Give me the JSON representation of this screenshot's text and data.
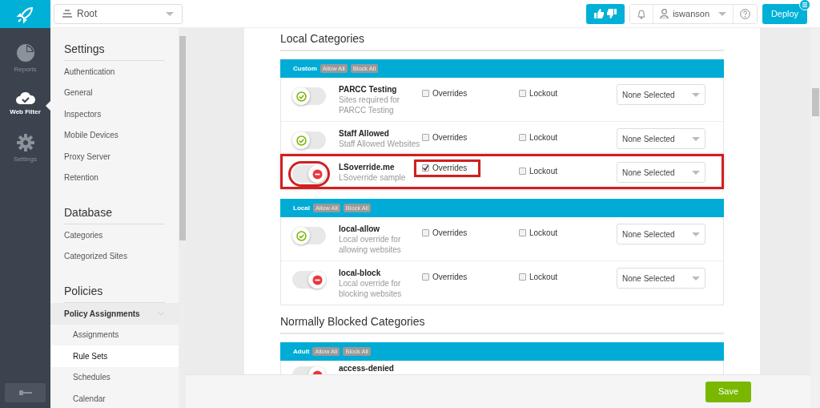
{
  "rail": [
    {
      "label": "Reports",
      "selected": false
    },
    {
      "label": "Web Filter",
      "selected": true
    },
    {
      "label": "Settings",
      "selected": false
    }
  ],
  "topbar": {
    "scope": "Root",
    "user": "iswanson",
    "deploy": "Deploy"
  },
  "sidebar": [
    {
      "heading": "Settings",
      "items": [
        {
          "label": "Authentication",
          "selected": false
        },
        {
          "label": "General",
          "selected": false
        },
        {
          "label": "Inspectors",
          "selected": false
        },
        {
          "label": "Mobile Devices",
          "selected": false
        },
        {
          "label": "Proxy Server",
          "selected": false
        },
        {
          "label": "Retention",
          "selected": false
        }
      ]
    },
    {
      "heading": "Database",
      "items": [
        {
          "label": "Categories",
          "selected": false
        },
        {
          "label": "Categorized Sites",
          "selected": false
        }
      ]
    },
    {
      "heading": "Policies",
      "items": [
        {
          "label": "Policy Assignments",
          "selected": false,
          "expanded": true,
          "children": [
            {
              "label": "Assignments",
              "selected": false
            },
            {
              "label": "Rule Sets",
              "selected": true
            },
            {
              "label": "Schedules",
              "selected": false
            },
            {
              "label": "Calendar",
              "selected": false
            }
          ]
        }
      ]
    }
  ],
  "sections": [
    {
      "title": "Local Categories",
      "groups": [
        {
          "name": "Custom",
          "allow": "Allow All",
          "block": "Block All",
          "rows": [
            {
              "name": "PARCC Testing",
              "description": "Sites required for PARCC Testing",
              "allowed": true,
              "overrides": {
                "label": "Overrides",
                "checked": false
              },
              "lockout": {
                "label": "Lockout",
                "checked": false
              },
              "select": "None Selected",
              "highlighted": false
            },
            {
              "name": "Staff Allowed",
              "description": "Staff Allowed Websites",
              "allowed": true,
              "overrides": {
                "label": "Overrides",
                "checked": false
              },
              "lockout": {
                "label": "Lockout",
                "checked": false
              },
              "select": "None Selected",
              "highlighted": false
            },
            {
              "name": "LSoverride.me",
              "description": "LSoverride sample",
              "allowed": false,
              "overrides": {
                "label": "Overrides",
                "checked": true
              },
              "lockout": {
                "label": "Lockout",
                "checked": false
              },
              "select": "None Selected",
              "highlighted": true
            }
          ]
        },
        {
          "name": "Local",
          "allow": "Allow All",
          "block": "Block All",
          "rows": [
            {
              "name": "local-allow",
              "description": "Local override for allowing websites",
              "allowed": true,
              "overrides": {
                "label": "Overrides",
                "checked": false
              },
              "lockout": {
                "label": "Lockout",
                "checked": false
              },
              "select": "None Selected",
              "highlighted": false
            },
            {
              "name": "local-block",
              "description": "Local override for blocking websites",
              "allowed": false,
              "overrides": {
                "label": "Overrides",
                "checked": false
              },
              "lockout": {
                "label": "Lockout",
                "checked": false
              },
              "select": "None Selected",
              "highlighted": false
            }
          ]
        }
      ]
    },
    {
      "title": "Normally Blocked Categories",
      "groups": [
        {
          "name": "Adult",
          "allow": "Allow All",
          "block": "Block All",
          "rows": [
            {
              "name": "access-denied",
              "allowed": false,
              "highlighted": false
            }
          ]
        }
      ]
    }
  ],
  "footer": {
    "save": "Save"
  }
}
